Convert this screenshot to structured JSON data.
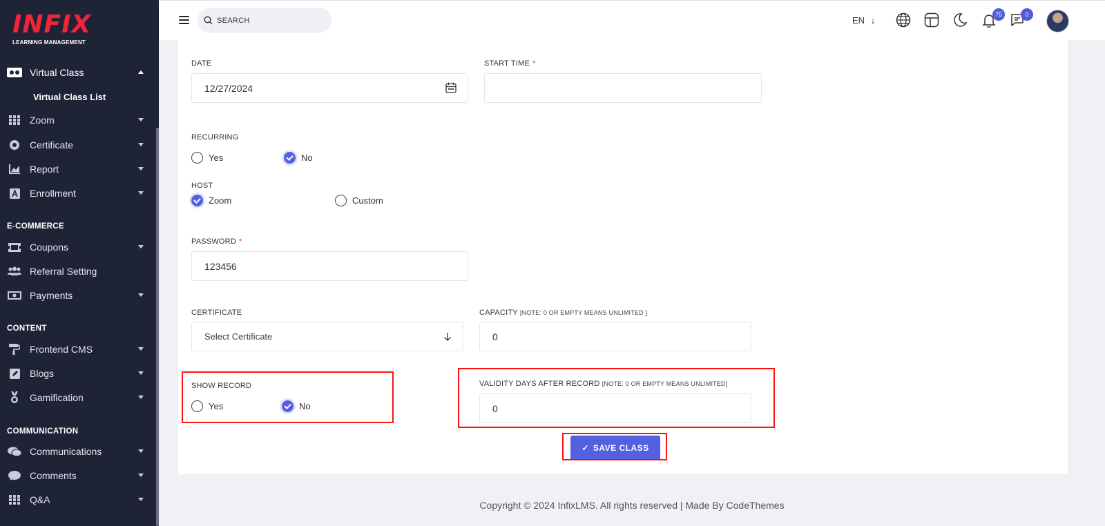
{
  "brand": {
    "name": "INFIX",
    "tagline": "LEARNING MANAGEMENT",
    "color": "#f0243a"
  },
  "sidebar": {
    "items": [
      {
        "label": "Virtual Class",
        "icon": "vr-headset-icon",
        "expanded": true
      },
      {
        "label": "Zoom",
        "icon": "grid-icon"
      },
      {
        "label": "Certificate",
        "icon": "badge-icon"
      },
      {
        "label": "Report",
        "icon": "chart-icon"
      },
      {
        "label": "Enrollment",
        "icon": "enrollment-icon"
      },
      {
        "label": "Coupons",
        "icon": "ticket-icon"
      },
      {
        "label": "Referral Setting",
        "icon": "users-icon"
      },
      {
        "label": "Payments",
        "icon": "money-icon"
      },
      {
        "label": "Frontend CMS",
        "icon": "paint-roller-icon"
      },
      {
        "label": "Blogs",
        "icon": "edit-icon"
      },
      {
        "label": "Gamification",
        "icon": "medal-icon"
      },
      {
        "label": "Communications",
        "icon": "chat-icon"
      },
      {
        "label": "Comments",
        "icon": "comment-icon"
      },
      {
        "label": "Q&A",
        "icon": "grid-icon"
      }
    ],
    "submenu": {
      "virtual_class_list": "Virtual Class List"
    },
    "sections": {
      "ecommerce": "E-COMMERCE",
      "content": "CONTENT",
      "communication": "COMMUNICATION"
    }
  },
  "topbar": {
    "search_placeholder": "SEARCH",
    "language": "EN",
    "notifications_count": "75",
    "messages_count": "0"
  },
  "form": {
    "date": {
      "label": "DATE",
      "value": "12/27/2024"
    },
    "start_time": {
      "label": "START TIME",
      "required": "*",
      "value": ""
    },
    "recurring": {
      "label": "RECURRING",
      "options": [
        "Yes",
        "No"
      ],
      "selected": "No"
    },
    "host": {
      "label": "HOST",
      "options": [
        "Zoom",
        "Custom"
      ],
      "selected": "Zoom"
    },
    "password": {
      "label": "PASSWORD",
      "required": "*",
      "value": "123456"
    },
    "certificate": {
      "label": "CERTIFICATE",
      "placeholder": "Select Certificate"
    },
    "capacity": {
      "label": "CAPACITY",
      "note": "[NOTE: 0 OR EMPTY MEANS UNLIMITED ]",
      "value": "0"
    },
    "show_record": {
      "label": "SHOW RECORD",
      "options": [
        "Yes",
        "No"
      ],
      "selected": "No"
    },
    "validity_days": {
      "label": "VALIDITY DAYS AFTER RECORD",
      "note": "[NOTE: 0 OR EMPTY MEANS UNLIMITED]",
      "value": "0"
    },
    "save_label": "SAVE CLASS"
  },
  "footer": {
    "text": "Copyright © 2024 InfixLMS. All rights reserved | Made By CodeThemes"
  },
  "colors": {
    "sidebar_bg": "#1e2336",
    "accent": "#5361e0",
    "highlight": "#ff1010"
  }
}
